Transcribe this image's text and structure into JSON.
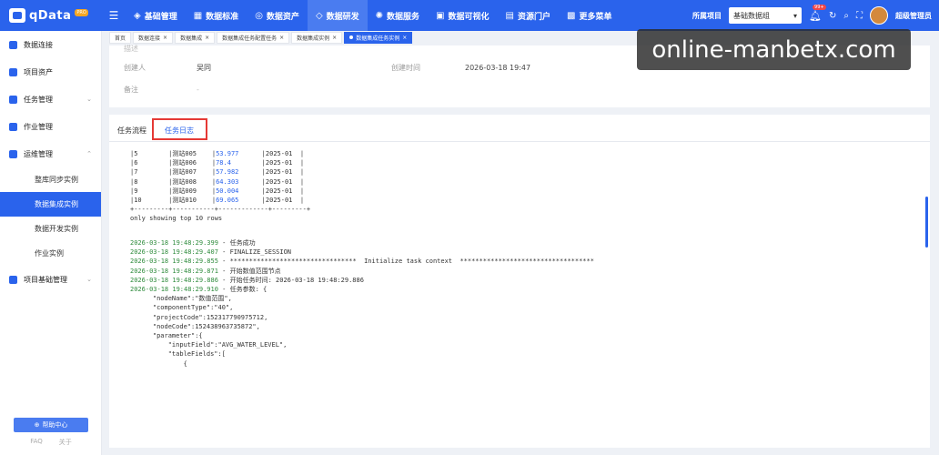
{
  "app": {
    "logo_text": "qData",
    "logo_badge": "PRO"
  },
  "nav": {
    "items": [
      {
        "label": "基础管理",
        "icon": "cube-icon"
      },
      {
        "label": "数据标准",
        "icon": "chart-icon"
      },
      {
        "label": "数据资产",
        "icon": "target-icon"
      },
      {
        "label": "数据研发",
        "icon": "code-icon"
      },
      {
        "label": "数据服务",
        "icon": "service-icon"
      },
      {
        "label": "数据可视化",
        "icon": "monitor-icon"
      },
      {
        "label": "资源门户",
        "icon": "portal-icon"
      },
      {
        "label": "更多菜单",
        "icon": "grid-icon"
      }
    ],
    "active_index": 3
  },
  "header_right": {
    "project_label": "所属项目",
    "project_value": "基础数据组",
    "badge": "99+",
    "user": "超级管理员"
  },
  "sidebar": {
    "items": [
      {
        "label": "数据连接"
      },
      {
        "label": "项目资产"
      },
      {
        "label": "任务管理"
      },
      {
        "label": "作业管理"
      },
      {
        "label": "运维管理"
      },
      {
        "label": "项目基础管理"
      }
    ],
    "sub_items": [
      {
        "label": "整库同步实例"
      },
      {
        "label": "数据集成实例"
      },
      {
        "label": "数据开发实例"
      },
      {
        "label": "作业实例"
      }
    ],
    "help": "帮助中心",
    "footer": [
      "FAQ",
      "关于"
    ]
  },
  "tabs": [
    {
      "label": "首页"
    },
    {
      "label": "数据连接"
    },
    {
      "label": "数据集成"
    },
    {
      "label": "数据集成任务配置任务"
    },
    {
      "label": "数据集成实例"
    },
    {
      "label": "数据集成任务实例"
    }
  ],
  "info": {
    "row0": {
      "label": "描述",
      "value": ""
    },
    "creator_label": "创建人",
    "creator_value": "吴同",
    "created_time_label": "创建时间",
    "created_time_value": "2026-03-18 19:47",
    "remark_label": "备注",
    "remark_value": "-"
  },
  "log_tabs": {
    "flow": "任务流程",
    "log": "任务日志"
  },
  "log": {
    "table_rows": [
      {
        "id": "5",
        "name": "测站005",
        "value": "53.977",
        "month": "2025-01"
      },
      {
        "id": "6",
        "name": "测站006",
        "value": "78.4",
        "month": "2025-01"
      },
      {
        "id": "7",
        "name": "测站007",
        "value": "57.982",
        "month": "2025-01"
      },
      {
        "id": "8",
        "name": "测站008",
        "value": "64.303",
        "month": "2025-01"
      },
      {
        "id": "9",
        "name": "测站009",
        "value": "50.004",
        "month": "2025-01"
      },
      {
        "id": "10",
        "name": "测站010",
        "value": "69.065",
        "month": "2025-01"
      }
    ],
    "table_border": "+---------+-----------+-------------+---------+",
    "only_showing": "only showing top 10 rows",
    "entries": [
      {
        "ts": "2026-03-18 19:48:29.399",
        "msg": " - 任务成功"
      },
      {
        "ts": "2026-03-18 19:48:29.407",
        "msg": " - FINALIZE_SESSION"
      },
      {
        "ts": "2026-03-18 19:48:29.855",
        "msg": " - *********************************  Initialize task context  ***********************************"
      },
      {
        "ts": "2026-03-18 19:48:29.871",
        "msg": " - 开始数值范围节点"
      },
      {
        "ts": "2026-03-18 19:48:29.886",
        "msg": " - 开始任务时间: 2026-03-18 19:48:29.886"
      },
      {
        "ts": "2026-03-18 19:48:29.910",
        "msg": " - 任务参数: {"
      }
    ],
    "params": [
      "    \"nodeName\":\"数值范围\",",
      "    \"componentType\":\"40\",",
      "    \"projectCode\":152317790975712,",
      "    \"nodeCode\":152438963735872\",",
      "    \"parameter\":{",
      "        \"inputField\":\"AVG_WATER_LEVEL\",",
      "        \"tableFields\":[",
      "            {"
    ]
  },
  "watermark": "online-manbetx.com"
}
